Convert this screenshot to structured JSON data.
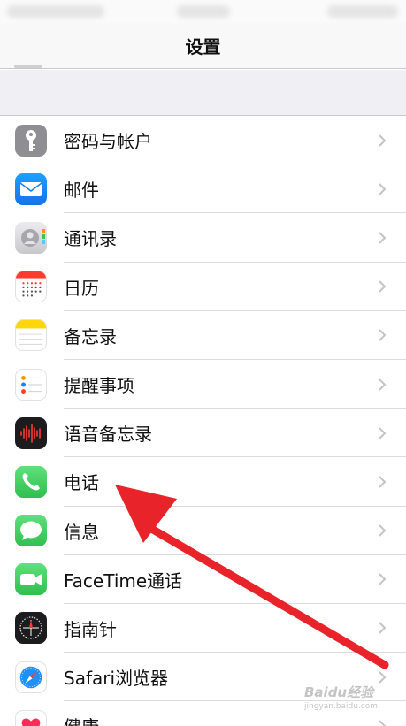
{
  "header": {
    "title": "设置"
  },
  "items": [
    {
      "label": "密码与帐户",
      "icon": "key-icon",
      "color": "#8e8e93"
    },
    {
      "label": "邮件",
      "icon": "mail-icon",
      "color": "#1a8cf5"
    },
    {
      "label": "通讯录",
      "icon": "contacts-icon",
      "color": "#d9d9dd"
    },
    {
      "label": "日历",
      "icon": "calendar-icon",
      "color": "#ffffff"
    },
    {
      "label": "备忘录",
      "icon": "notes-icon",
      "color": "#ffffff"
    },
    {
      "label": "提醒事项",
      "icon": "reminders-icon",
      "color": "#ffffff"
    },
    {
      "label": "语音备忘录",
      "icon": "voice-memos-icon",
      "color": "#1c1c1e"
    },
    {
      "label": "电话",
      "icon": "phone-icon",
      "color": "#34c759"
    },
    {
      "label": "信息",
      "icon": "messages-icon",
      "color": "#34c759"
    },
    {
      "label": "FaceTime通话",
      "icon": "facetime-icon",
      "color": "#34c759"
    },
    {
      "label": "指南针",
      "icon": "compass-icon",
      "color": "#1c1c1e"
    },
    {
      "label": "Safari浏览器",
      "icon": "safari-icon",
      "color": "#ffffff"
    },
    {
      "label": "健康",
      "icon": "health-icon",
      "color": "#ffffff"
    }
  ],
  "annotation": {
    "type": "arrow",
    "color": "#e8232a",
    "points_to": "电话"
  },
  "watermark": {
    "text": "Baidu经验",
    "sub": "jingyan.baidu.com"
  }
}
